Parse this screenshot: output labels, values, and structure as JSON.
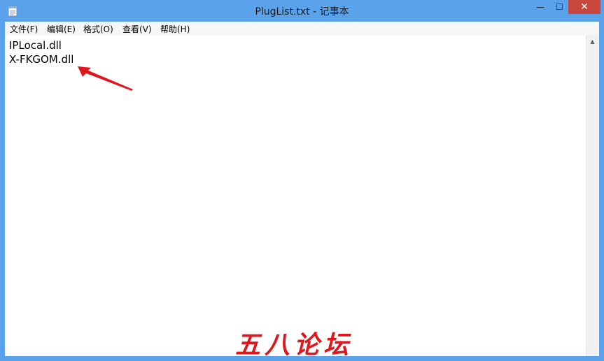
{
  "window": {
    "title": "PlugList.txt - 记事本",
    "icon": "notepad-icon"
  },
  "caption_buttons": {
    "minimize_icon": "minimize-icon",
    "maximize_icon": "maximize-icon",
    "close_icon": "close-icon",
    "minimize_glyph": "—",
    "maximize_glyph": "☐",
    "close_glyph": "✕",
    "close_color": "#c8463c"
  },
  "menu": {
    "items": [
      {
        "label": "文件(F)"
      },
      {
        "label": "编辑(E)"
      },
      {
        "label": "格式(O)"
      },
      {
        "label": "查看(V)"
      },
      {
        "label": "帮助(H)"
      }
    ]
  },
  "document": {
    "lines": [
      "IPLocal.dll",
      "X-FKGOM.dll"
    ]
  },
  "annotation": {
    "arrow_icon": "red-arrow-icon",
    "color": "#e0161d"
  },
  "watermark": {
    "text": "五八论坛"
  },
  "colors": {
    "titlebar": "#5aa2ea",
    "menubar": "#f5f6f7",
    "editor": "#ffffff"
  }
}
